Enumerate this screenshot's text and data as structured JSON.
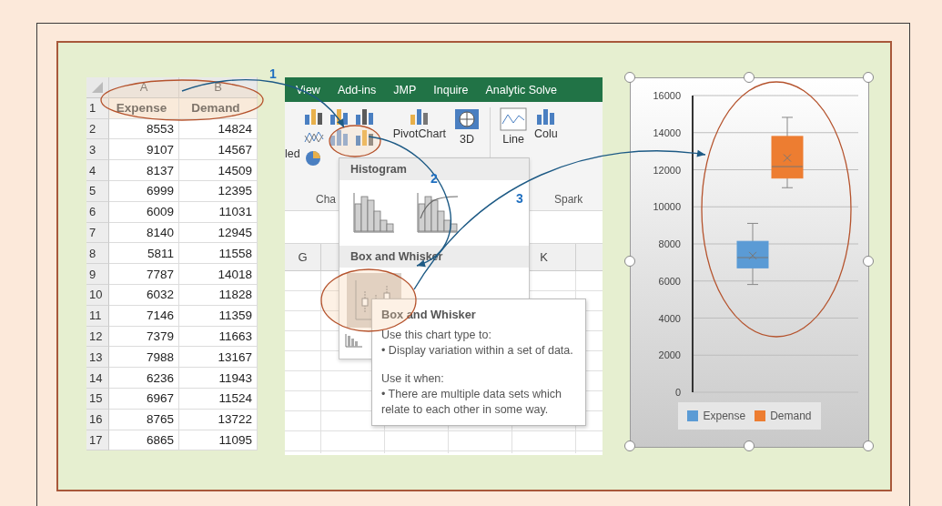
{
  "spreadsheet": {
    "columns": [
      "A",
      "B"
    ],
    "rows": [
      {
        "number": "1",
        "kind": "header",
        "cells": [
          "Expense",
          "Demand"
        ]
      },
      {
        "number": "2",
        "kind": "data",
        "cells": [
          "8553",
          "14824"
        ]
      },
      {
        "number": "3",
        "kind": "data",
        "cells": [
          "9107",
          "14567"
        ]
      },
      {
        "number": "4",
        "kind": "data",
        "cells": [
          "8137",
          "14509"
        ]
      },
      {
        "number": "5",
        "kind": "data",
        "cells": [
          "6999",
          "12395"
        ]
      },
      {
        "number": "6",
        "kind": "data",
        "cells": [
          "6009",
          "11031"
        ]
      },
      {
        "number": "7",
        "kind": "data",
        "cells": [
          "8140",
          "12945"
        ]
      },
      {
        "number": "8",
        "kind": "data",
        "cells": [
          "5811",
          "11558"
        ]
      },
      {
        "number": "9",
        "kind": "data",
        "cells": [
          "7787",
          "14018"
        ]
      },
      {
        "number": "10",
        "kind": "data",
        "cells": [
          "6032",
          "11828"
        ]
      },
      {
        "number": "11",
        "kind": "data",
        "cells": [
          "7146",
          "11359"
        ]
      },
      {
        "number": "12",
        "kind": "data",
        "cells": [
          "7379",
          "11663"
        ]
      },
      {
        "number": "13",
        "kind": "data",
        "cells": [
          "7988",
          "13167"
        ]
      },
      {
        "number": "14",
        "kind": "data",
        "cells": [
          "6236",
          "11943"
        ]
      },
      {
        "number": "15",
        "kind": "data",
        "cells": [
          "6967",
          "11524"
        ]
      },
      {
        "number": "16",
        "kind": "data",
        "cells": [
          "8765",
          "13722"
        ]
      },
      {
        "number": "17",
        "kind": "data",
        "cells": [
          "6865",
          "11095"
        ]
      }
    ]
  },
  "excel": {
    "tabs": [
      "View",
      "Add-ins",
      "JMP",
      "Inquire",
      "Analytic Solve"
    ],
    "ribbon": {
      "recommended_label": "led",
      "pivotchart_label": "PivotChart",
      "map_label": "3D",
      "line_label": "Line",
      "column_label": "Colu",
      "groups": [
        "Cha",
        "Spark"
      ]
    },
    "column_headers": [
      "G",
      "K"
    ],
    "dropdown": {
      "sections": [
        {
          "title": "Histogram",
          "items": [
            {
              "kind": "histogram",
              "selected": false
            },
            {
              "kind": "pareto",
              "selected": false
            }
          ]
        },
        {
          "title": "Box and Whisker",
          "items": [
            {
              "kind": "box-whisker",
              "selected": true
            }
          ]
        }
      ]
    },
    "tooltip": {
      "title": "Box and Whisker",
      "sections": [
        {
          "heading": "Use this chart type to:",
          "bullet": "• Display variation within a set of data."
        },
        {
          "heading": "Use it when:",
          "bullet": "• There are multiple data sets which relate to each other in some way."
        }
      ]
    }
  },
  "chart": {
    "yticks": [
      "16000",
      "14000",
      "12000",
      "10000",
      "8000",
      "6000",
      "4000",
      "2000",
      "0"
    ],
    "legend": [
      {
        "label": "Expense",
        "color": "#5b9bd5"
      },
      {
        "label": "Demand",
        "color": "#ed7d31"
      }
    ]
  },
  "callouts": [
    {
      "label": "1"
    },
    {
      "label": "2"
    },
    {
      "label": "3"
    }
  ]
}
